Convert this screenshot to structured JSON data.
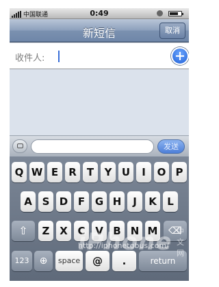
{
  "status_bar": {
    "carrier": "中国联通",
    "time": "0:49"
  },
  "nav": {
    "title": "新短信",
    "cancel_label": "取消"
  },
  "recipient": {
    "label": "收件人:"
  },
  "compose": {
    "send_label": "发送",
    "message_value": ""
  },
  "keyboard": {
    "row1": [
      "Q",
      "W",
      "E",
      "R",
      "T",
      "Y",
      "U",
      "I",
      "O",
      "P"
    ],
    "row2": [
      "A",
      "S",
      "D",
      "F",
      "G",
      "H",
      "J",
      "K",
      "L"
    ],
    "row3": [
      "Z",
      "X",
      "C",
      "V",
      "B",
      "N",
      "M"
    ],
    "numbers_label": "123",
    "space_label": "space",
    "at_label": "@",
    "dot_label": ".",
    "return_label": "return"
  },
  "watermark": {
    "text": "iPhone",
    "url": "http://iphonetgbus.com/",
    "cn": "中文网"
  },
  "colors": {
    "nav_blue": "#7b91b0",
    "send_blue": "#4d7fd8",
    "add_blue": "#1f5fd6"
  }
}
